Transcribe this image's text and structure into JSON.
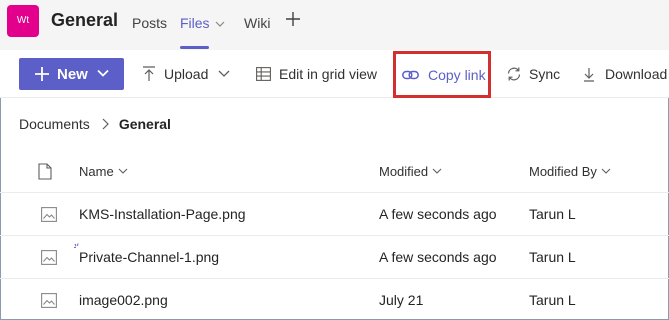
{
  "channel": {
    "team_initials": "Wt",
    "title": "General",
    "tabs": [
      {
        "label": "Posts"
      },
      {
        "label": "Files"
      },
      {
        "label": "Wiki"
      }
    ]
  },
  "commandbar": {
    "new_label": "New",
    "upload_label": "Upload",
    "grid_label": "Edit in grid view",
    "copy_link_label": "Copy link",
    "sync_label": "Sync",
    "download_label": "Download"
  },
  "breadcrumb": {
    "root": "Documents",
    "current": "General"
  },
  "list": {
    "columns": {
      "name": "Name",
      "modified": "Modified",
      "modified_by": "Modified By"
    },
    "rows": [
      {
        "name": "KMS-Installation-Page.png",
        "modified": "A few seconds ago",
        "modified_by": "Tarun L"
      },
      {
        "name": "Private-Channel-1.png",
        "modified": "A few seconds ago",
        "modified_by": "Tarun L"
      },
      {
        "name": "image002.png",
        "modified": "July 21",
        "modified_by": "Tarun L"
      }
    ]
  },
  "colors": {
    "accent": "#5b5fc7",
    "team_avatar": "#e3008c",
    "highlight_box": "#d32f2f"
  }
}
